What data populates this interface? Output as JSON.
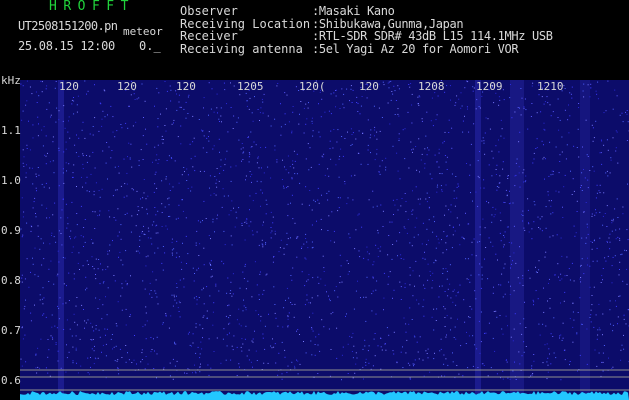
{
  "header": {
    "app_title": "HROFFT",
    "file_name": "UT2508151200.pn",
    "meteor_label": "meteor",
    "date_time": "25.08.15 12:00",
    "count": "0._"
  },
  "station_info": [
    {
      "label": "Observer",
      "value": ":Masaki Kano"
    },
    {
      "label": "Receiving Location",
      "value": ":Shibukawa,Gunma,Japan"
    },
    {
      "label": "Receiver",
      "value": ":RTL-SDR SDR# 43dB L15 114.1MHz USB"
    },
    {
      "label": "Receiving antenna",
      "value": ":5el Yagi Az 20 for Aomori VOR"
    }
  ],
  "frequency_axis": {
    "unit": "kHz",
    "ticks": [
      "1.1",
      "1.0",
      "0.9",
      "0.8",
      "0.7",
      "0.6"
    ]
  },
  "time_axis": {
    "ticks": [
      "120",
      "120",
      "120",
      "1205",
      "120(",
      "120",
      "1208",
      "1209",
      "1210"
    ]
  },
  "colors": {
    "background": "#000000",
    "title_green": "#21d33c",
    "text": "#d8d8d8",
    "spectrum_bg": "#0c0c6a",
    "noise_floor": "#22c8ff",
    "guide_lines": "#bcbc9a"
  }
}
